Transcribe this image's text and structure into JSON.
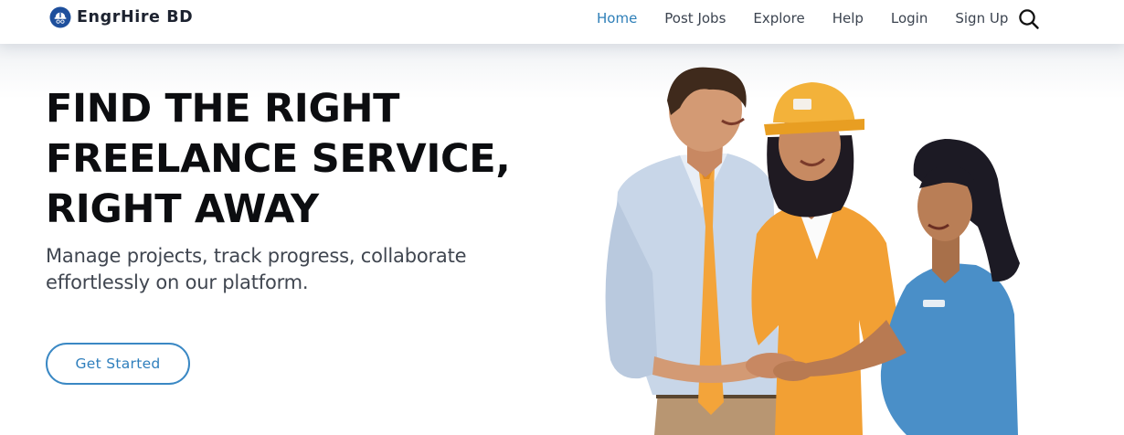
{
  "header": {
    "brand": "EngrHire BD",
    "nav": [
      {
        "label": "Home",
        "active": true
      },
      {
        "label": "Post Jobs",
        "active": false
      },
      {
        "label": "Explore",
        "active": false
      },
      {
        "label": "Help",
        "active": false
      },
      {
        "label": "Login",
        "active": false
      },
      {
        "label": "Sign Up",
        "active": false
      }
    ],
    "search_icon": "search-icon"
  },
  "hero": {
    "title_lines": [
      "FIND THE RIGHT",
      "FREELANCE SERVICE,",
      "RIGHT AWAY"
    ],
    "subtitle_lines": [
      "Manage projects, track progress, collaborate",
      "effortlessly on our platform."
    ],
    "cta_label": "Get Started",
    "illustration": "three-professionals-handshake-illustration"
  },
  "colors": {
    "accent": "#2e7fb8",
    "text_dark": "#0c0d10",
    "nav_text": "#3c4450",
    "logo_blue": "#1e4f9c"
  }
}
